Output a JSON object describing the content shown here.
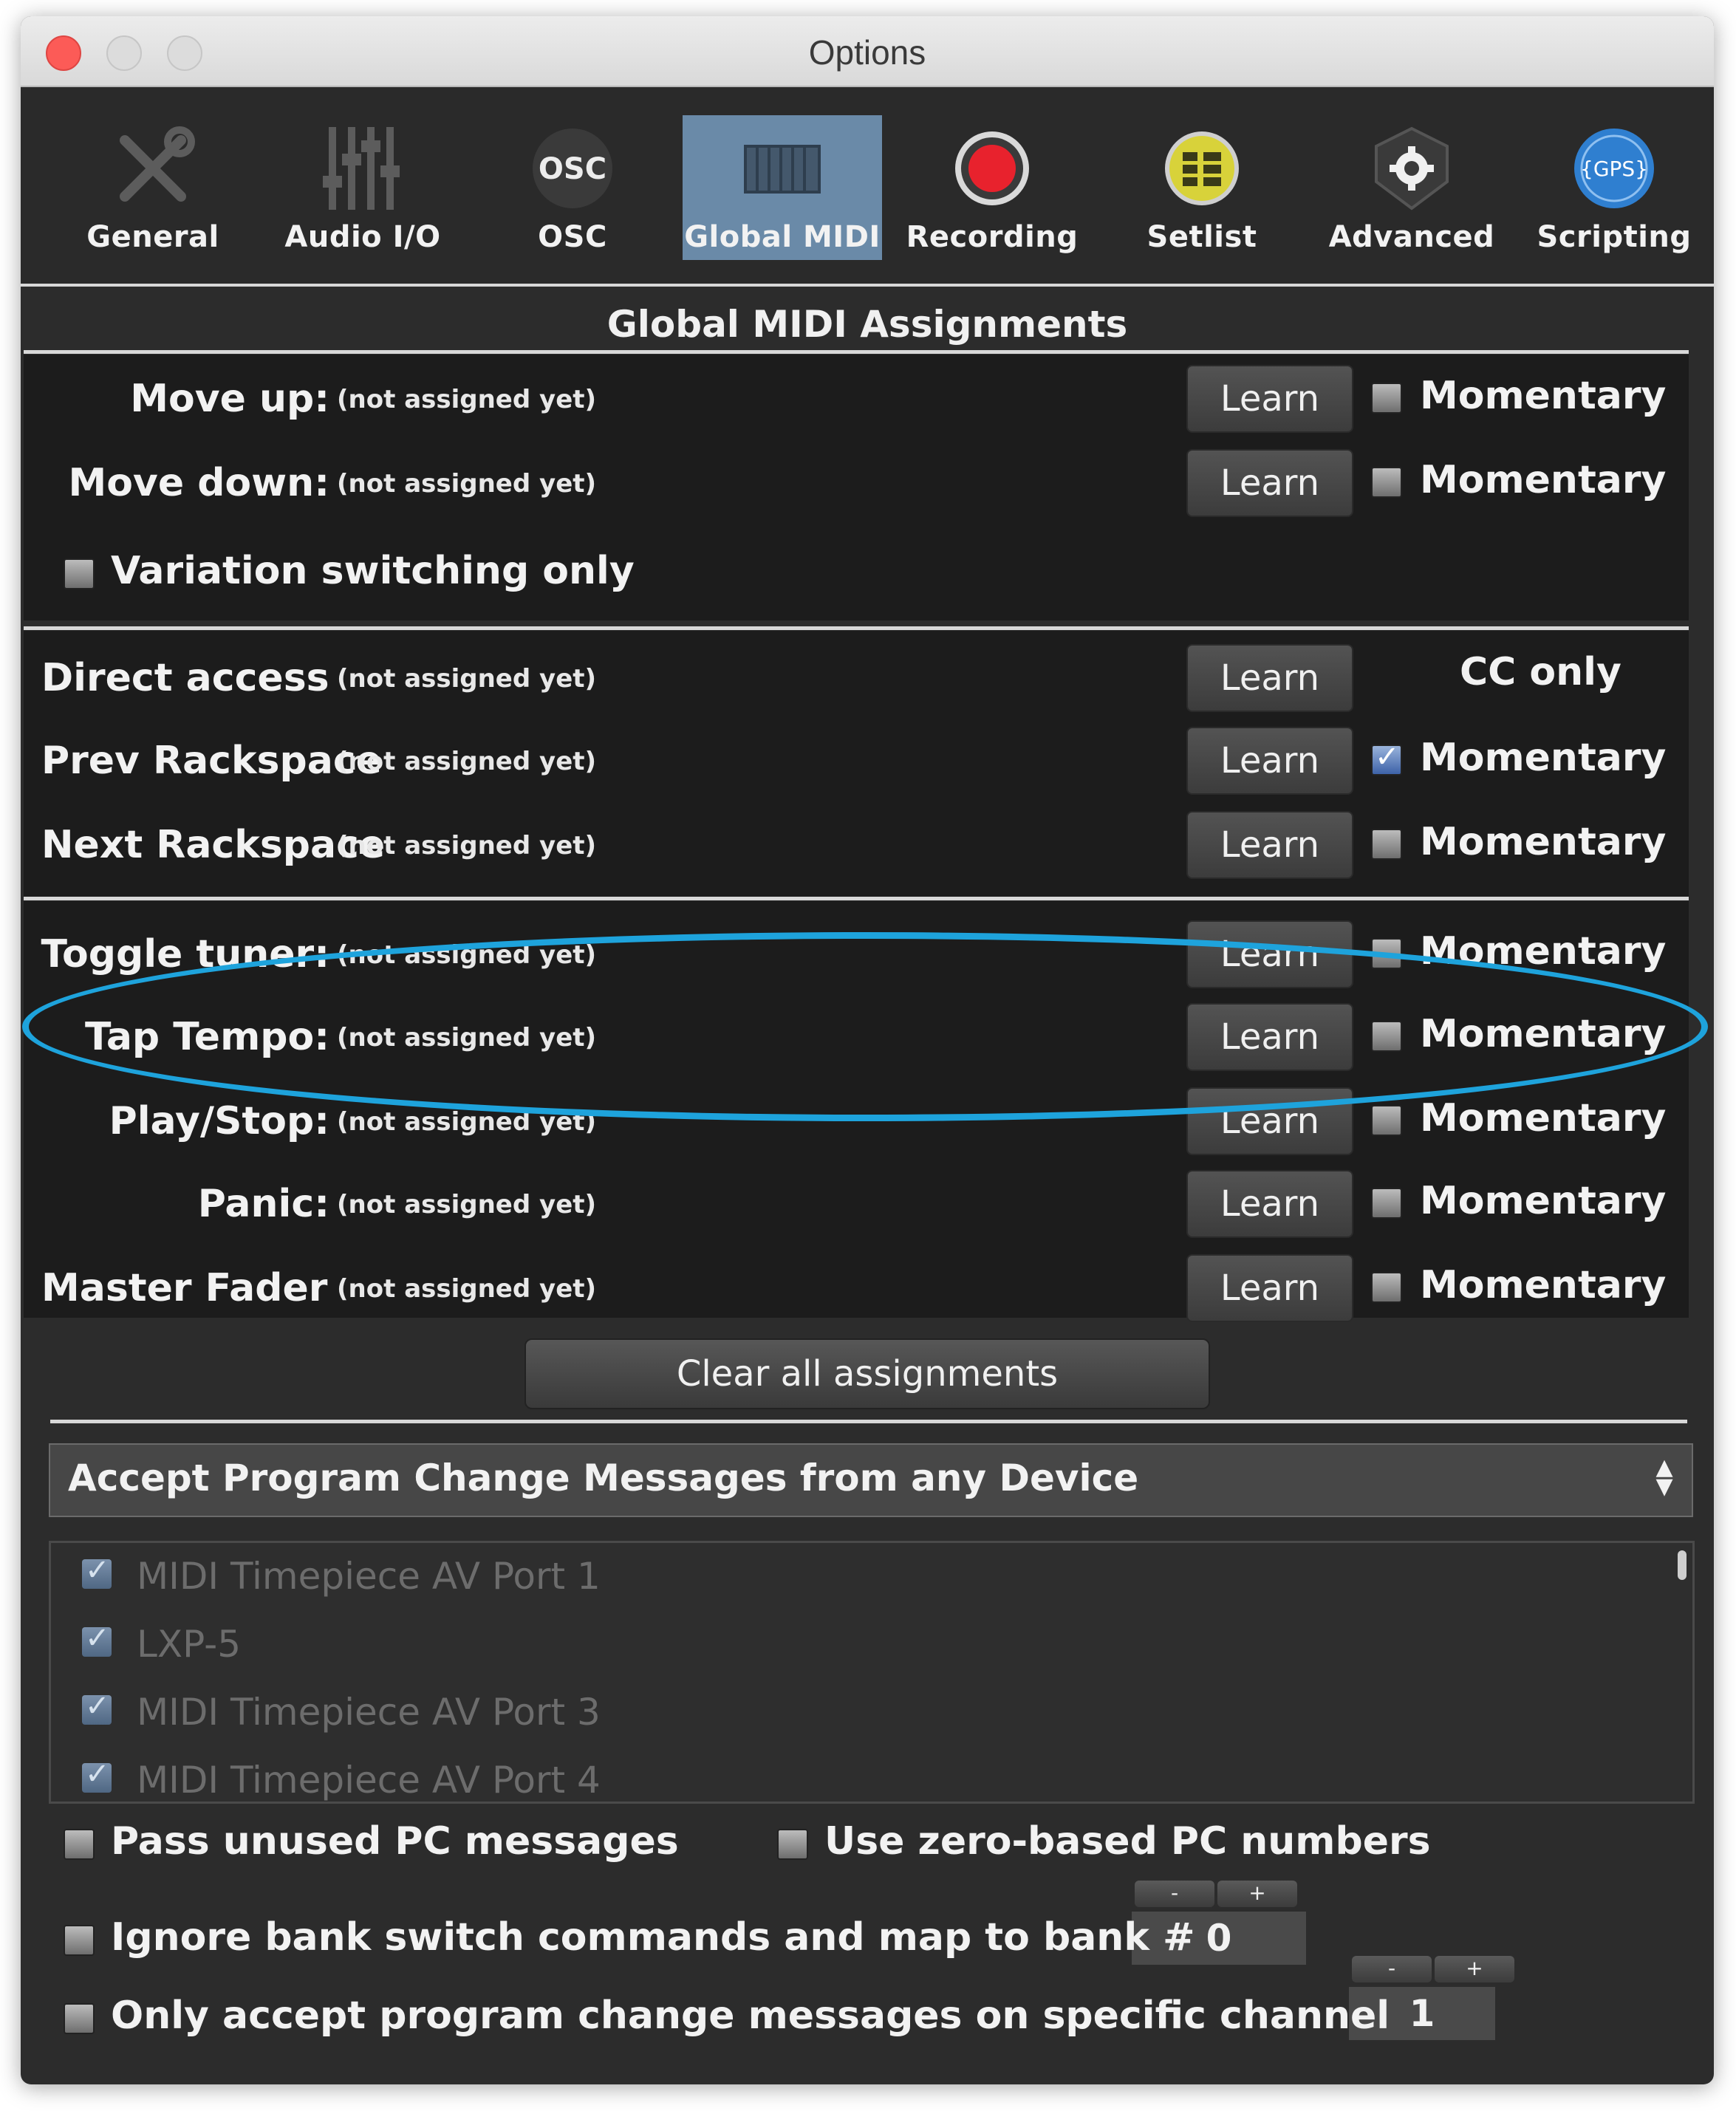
{
  "window": {
    "title": "Options"
  },
  "toolbar": {
    "items": [
      {
        "label": "General",
        "icon": "wrench-screwdriver-icon",
        "active": false
      },
      {
        "label": "Audio I/O",
        "icon": "mixer-sliders-icon",
        "active": false
      },
      {
        "label": "OSC",
        "icon": "osc-icon",
        "active": false
      },
      {
        "label": "Global MIDI",
        "icon": "keyboard-icon",
        "active": true
      },
      {
        "label": "Recording",
        "icon": "record-icon",
        "active": false
      },
      {
        "label": "Setlist",
        "icon": "setlist-icon",
        "active": false
      },
      {
        "label": "Advanced",
        "icon": "gear-shield-icon",
        "active": false
      },
      {
        "label": "Scripting",
        "icon": "gps-icon",
        "active": false
      }
    ],
    "osc_icon_text": "OSC",
    "gps_icon_text": "{GPS}"
  },
  "section_title": "Global MIDI Assignments",
  "not_assigned": "(not assigned yet)",
  "learn_label": "Learn",
  "momentary_label": "Momentary",
  "cc_only_label": "CC only",
  "groups": {
    "navigation": [
      {
        "label": "Move up:",
        "status": "(not assigned yet)",
        "momentary": false
      },
      {
        "label": "Move down:",
        "status": "(not assigned yet)",
        "momentary": false
      }
    ],
    "variation_only": {
      "label": "Variation switching only",
      "checked": false
    },
    "rackspace": [
      {
        "label": "Direct access",
        "status": "(not assigned yet)",
        "cc_only": true
      },
      {
        "label": "Prev Rackspace",
        "status": "(not assigned yet)",
        "momentary": true
      },
      {
        "label": "Next Rackspace",
        "status": "(not assigned yet)",
        "momentary": false
      }
    ],
    "transport": [
      {
        "label": "Toggle tuner:",
        "status": "(not assigned yet)",
        "momentary": false
      },
      {
        "label": "Tap Tempo:",
        "status": "(not assigned yet)",
        "momentary": false
      },
      {
        "label": "Play/Stop:",
        "status": "(not assigned yet)",
        "momentary": false
      },
      {
        "label": "Panic:",
        "status": "(not assigned yet)",
        "momentary": false
      },
      {
        "label": "Master Fader",
        "status": "(not assigned yet)",
        "momentary": false
      }
    ]
  },
  "clear_button": "Clear all assignments",
  "pc_source": {
    "selected": "Accept Program Change Messages from any Device"
  },
  "devices": [
    {
      "label": "MIDI Timepiece AV Port 1",
      "checked": true
    },
    {
      "label": "LXP-5",
      "checked": true
    },
    {
      "label": "MIDI Timepiece AV Port 3",
      "checked": true
    },
    {
      "label": "MIDI Timepiece AV Port 4",
      "checked": true
    }
  ],
  "options": {
    "pass_unused": {
      "label": "Pass unused PC messages",
      "checked": false
    },
    "zero_based": {
      "label": "Use zero-based PC numbers",
      "checked": false
    },
    "ignore_bank": {
      "label": "Ignore bank switch commands and map to bank #",
      "checked": false,
      "value": "0"
    },
    "specific_channel": {
      "label": "Only accept program change messages on specific channel",
      "checked": false,
      "value": "1"
    }
  },
  "stepper": {
    "minus": "-",
    "plus": "+"
  },
  "colors": {
    "highlight": "#1ea3dc",
    "active_tab": "#6a8aa8",
    "record": "#e8222d",
    "setlist": "#d8d23a",
    "scripting": "#2f7fd0"
  }
}
